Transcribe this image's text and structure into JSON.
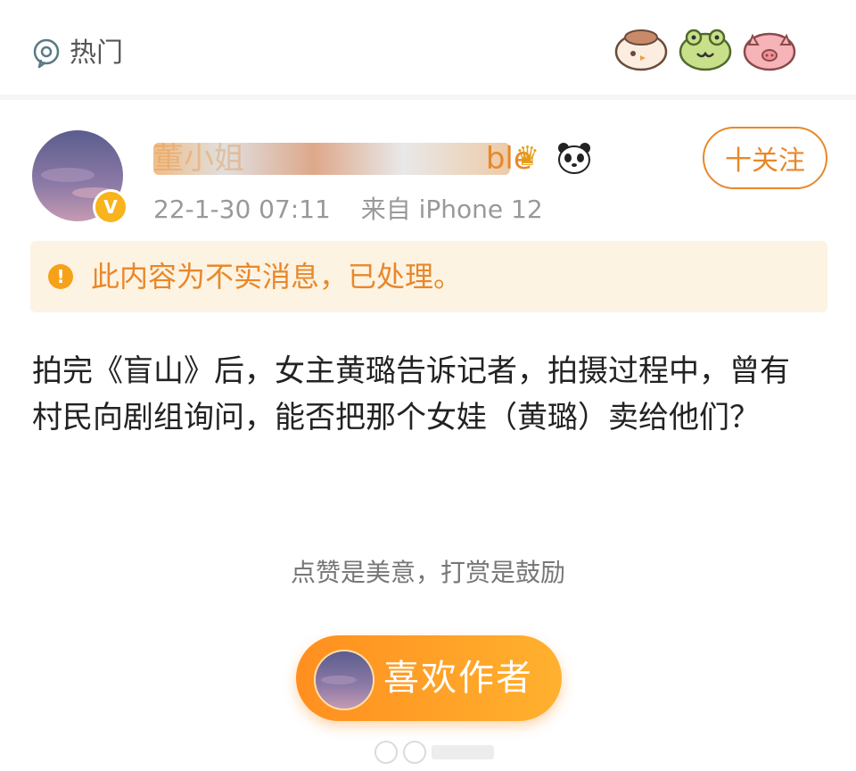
{
  "header": {
    "hot_label": "热门",
    "hot_icon": "hot-topic-icon",
    "emoji_icons": [
      "bird-emoji-icon",
      "frog-emoji-icon",
      "pig-emoji-icon"
    ]
  },
  "post": {
    "author_name": "董小姐",
    "author_name_suffix": "ble",
    "verified_badge": "V",
    "time": "22-1-30 07:11",
    "source": "来自 iPhone 12",
    "follow_label": "十关注",
    "warning_text": "此内容为不实消息，已处理。",
    "warning_icon_symbol": "!",
    "content": "拍完《盲山》后，女主黄璐告诉记者，拍摄过程中，曾有村民向剧组询问，能否把那个女娃（黄璐）卖给他们？",
    "reward_text": "点赞是美意，打赏是鼓励",
    "like_author_label": "喜欢作者"
  },
  "colors": {
    "accent": "#e8882a",
    "warning_bg": "#fdf3e2",
    "button_gradient_start": "#ff8f1f",
    "button_gradient_end": "#ffb12e"
  }
}
